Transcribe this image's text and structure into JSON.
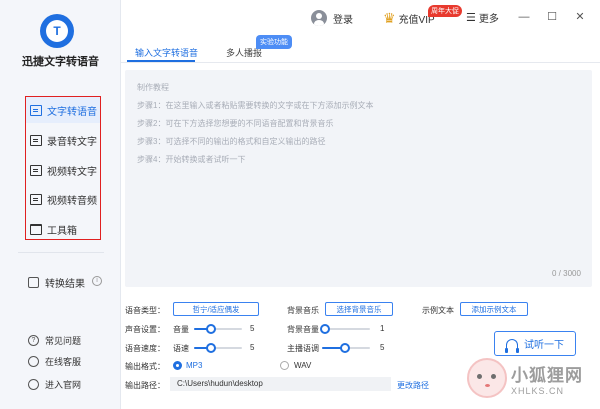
{
  "app": {
    "title": "迅捷文字转语音"
  },
  "sidebar": {
    "items": [
      {
        "label": "文字转语音",
        "active": true
      },
      {
        "label": "录音转文字"
      },
      {
        "label": "视频转文字"
      },
      {
        "label": "视频转音频"
      },
      {
        "label": "工具箱"
      }
    ],
    "results": "转换结果",
    "links": [
      "常见问题",
      "在线客服",
      "进入官网"
    ]
  },
  "topbar": {
    "login": "登录",
    "vip": "充值VIP",
    "vip_badge": "周年大促",
    "more": "更多",
    "minimize": "—",
    "maximize": "☐",
    "close": "✕"
  },
  "tabs": {
    "items": [
      "输入文字转语音",
      "多人播报"
    ],
    "lab_badge": "实验功能"
  },
  "editor": {
    "hints": [
      "制作教程",
      "步骤1：在这里输入或者粘贴需要转换的文字或在下方添加示例文本",
      "步骤2：可在下方选择您想要的不同语音配置和背景音乐",
      "步骤3：可选择不同的输出的格式和自定义输出的路径",
      "步骤4：开始转换或者试听一下"
    ],
    "counter": "0 / 3000"
  },
  "settings": {
    "voice_type_label": "语音类型：",
    "voice_type_btn": "哲宁/适应偶发",
    "bgm_label": "背景音乐",
    "bgm_btn": "选择背景音乐",
    "sample_label": "示例文本",
    "sample_btn": "添加示例文本",
    "sound_label": "声音设置：",
    "volume_label": "音量",
    "volume_value": "5",
    "bgm_volume_label": "背景音量",
    "bgm_volume_value": "1",
    "speed_label": "语音速度：",
    "rate_label": "语速",
    "rate_value": "5",
    "pitch_label": "主播语调",
    "pitch_value": "5",
    "format_label": "输出格式：",
    "format_options": [
      "MP3",
      "WAV"
    ],
    "path_label": "输出路径：",
    "path_value": "C:\\Users\\hudun\\desktop",
    "change_path": "更改路径",
    "listen_btn": "试听一下"
  },
  "watermark": {
    "big": "小狐狸网",
    "small": "XHLKS.CN"
  },
  "colors": {
    "accent": "#1f6fe0",
    "highlight_box": "#e02020"
  }
}
